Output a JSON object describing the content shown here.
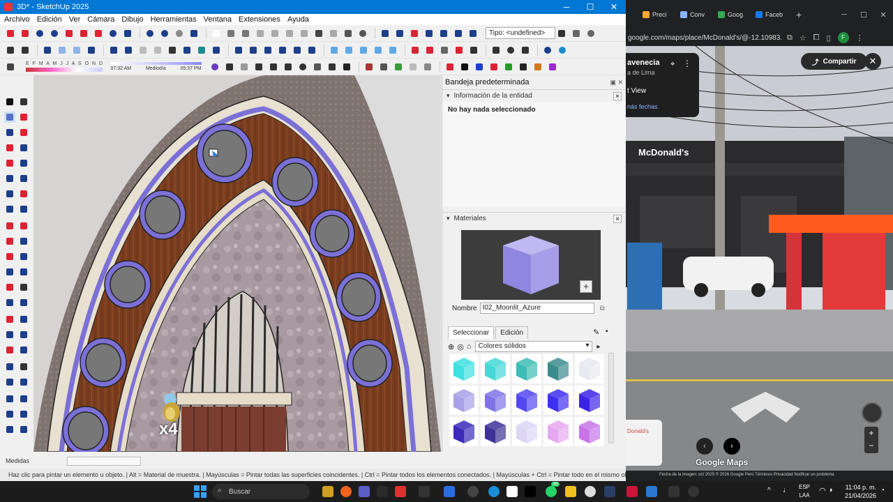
{
  "sketchup": {
    "title": "3D* - SketchUp 2025",
    "menu": [
      "Archivo",
      "Edición",
      "Ver",
      "Cámara",
      "Dibujo",
      "Herramientas",
      "Ventana",
      "Extensiones",
      "Ayuda"
    ],
    "tipo_field": "Tipo: <undefined>",
    "shadows": {
      "months": "E F M A M J J A S O N D",
      "time_start": "07:32 AM",
      "time_mid": "Mediodía",
      "time_end": "05:37 PM"
    },
    "tray": {
      "title": "Bandeja predeterminada",
      "entity_panel": "Información de la entidad",
      "entity_empty": "No hay nada seleccionado",
      "materials_panel": "Materiales",
      "name_label": "Nombre",
      "name_value": "I02_Moonlit_Azure",
      "tab_select": "Seleccionar",
      "tab_edit": "Edición",
      "library": "Colores sólidos",
      "swatch_colors": [
        "#3fe0e0",
        "#44d8d8",
        "#3bbcb4",
        "#3a8c8c",
        "#e8e8f0",
        "#a9a0e8",
        "#7f74e6",
        "#5347f0",
        "#3f2ff0",
        "#3a24e8",
        "#3a2bb8",
        "#3e3296",
        "#dcd6f4",
        "#e6a8f0",
        "#c874e8"
      ]
    },
    "measure_label": "Medidas",
    "status_text": "Haz clic para pintar un elemento u objeto. | Alt = Material de muestra. | Mayúsculas = Pintar todas las superficies coincidentes. | Ctrl = Pintar todos los elementos conectados. | Mayúsculas + Ctrl = Pintar todo en el mismo obj",
    "viewport_badge": "x4"
  },
  "chrome": {
    "tabs": [
      {
        "label": "Preci",
        "color": "#f3a833"
      },
      {
        "label": "Conv",
        "color": "#8ab4f8"
      },
      {
        "label": "Goog",
        "color": "#34a853"
      },
      {
        "label": "Faceb",
        "color": "#1877f2"
      }
    ],
    "url": "google.com/maps/place/McDonald's/@-12.10983...",
    "profile_initial": "F",
    "maps": {
      "place_title": "avenecia",
      "place_sub": "a de Lima",
      "street_view": "t View",
      "more_dates": "nás fechas",
      "share": "Compartir",
      "sign": "McDonald's",
      "logo": "Google Maps",
      "mini_label": "Donald's",
      "footer": "Fecha de la imagen: oct 2025   © 2026 Google   Perú   Términos   Privacidad   Notificar un problema"
    }
  },
  "taskbar": {
    "search": "Buscar",
    "lang_1": "ESP",
    "lang_2": "LAA",
    "time": "11:04 p. m.",
    "date": "21/04/2026",
    "notif_badge": "39"
  }
}
